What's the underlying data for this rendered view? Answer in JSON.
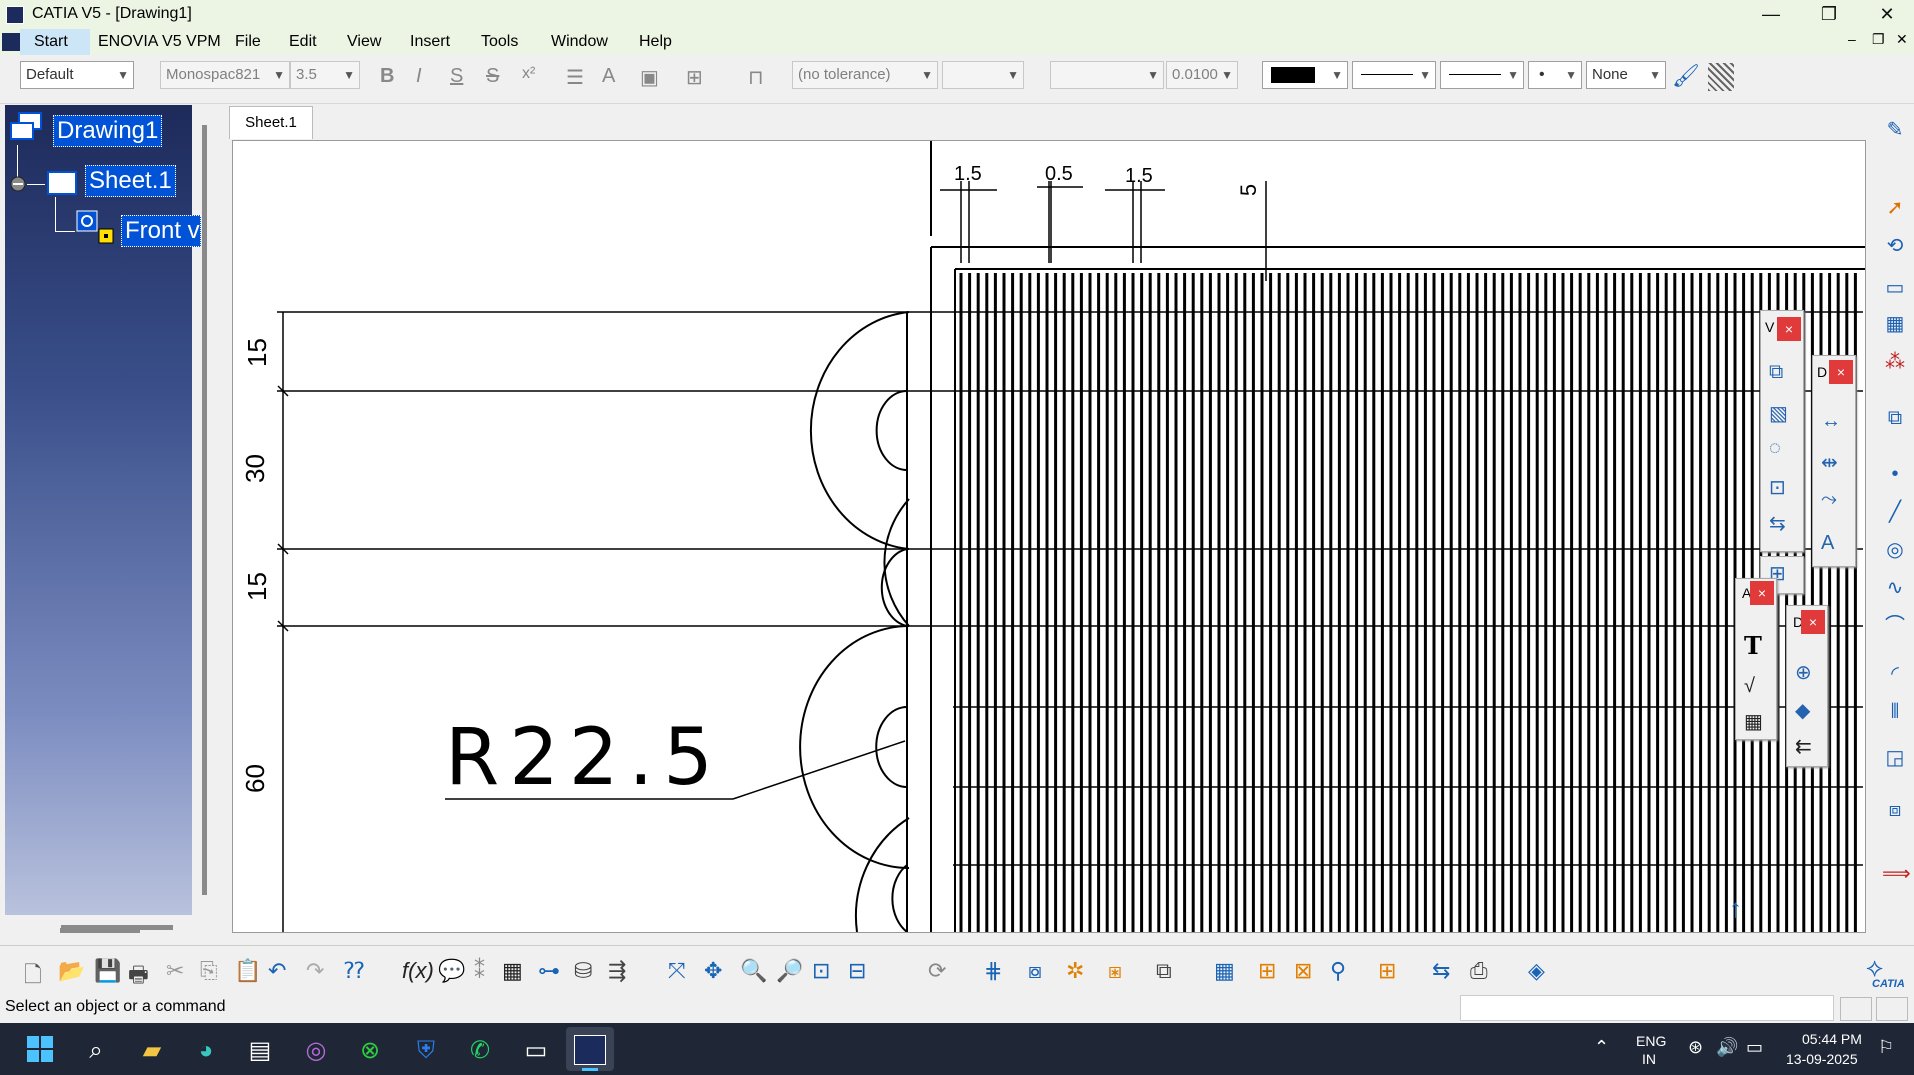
{
  "window": {
    "title": "CATIA V5 - [Drawing1]",
    "controls": {
      "minimize": "—",
      "restore": "❐",
      "close": "✕"
    },
    "doc_controls": {
      "minimize": "–",
      "restore": "❐",
      "close": "✕"
    }
  },
  "menu": {
    "items": [
      "Start",
      "ENOVIA V5 VPM",
      "File",
      "Edit",
      "View",
      "Insert",
      "Tools",
      "Window",
      "Help"
    ]
  },
  "toolbar": {
    "style": "Default",
    "font": "Monospac821",
    "font_size": "3.5",
    "bold": "B",
    "italic": "I",
    "underline": "S",
    "strike": "S",
    "superscript": "x²",
    "tolerance": "(no tolerance)",
    "precision": "0.0100",
    "line_pattern_none": "None"
  },
  "tree": {
    "root": "Drawing1",
    "sheet": "Sheet.1",
    "view": "Front v"
  },
  "sheet_tab": "Sheet.1",
  "drawing": {
    "top_dims": [
      "1.5",
      "0.5",
      "1.5",
      "5"
    ],
    "left_dims": [
      "15",
      "30",
      "15",
      "60"
    ],
    "radius_label": "R22.5"
  },
  "palettes": {
    "views_label": "V",
    "dims_label": "D",
    "annot_label": "A",
    "dress_label": "D",
    "text_tool": "T"
  },
  "status": {
    "text": "Select an object or a command"
  },
  "bottom_brand": "CATIA",
  "taskbar": {
    "lang_top": "ENG",
    "lang_bottom": "IN",
    "time": "05:44 PM",
    "date": "13-09-2025"
  },
  "colors": {
    "titlebar": "#ecf5e4",
    "tree_top": "#1d2a5a",
    "node_highlight": "#0052d6",
    "close_red": "#e03a3a",
    "taskbar": "#1f2635"
  }
}
